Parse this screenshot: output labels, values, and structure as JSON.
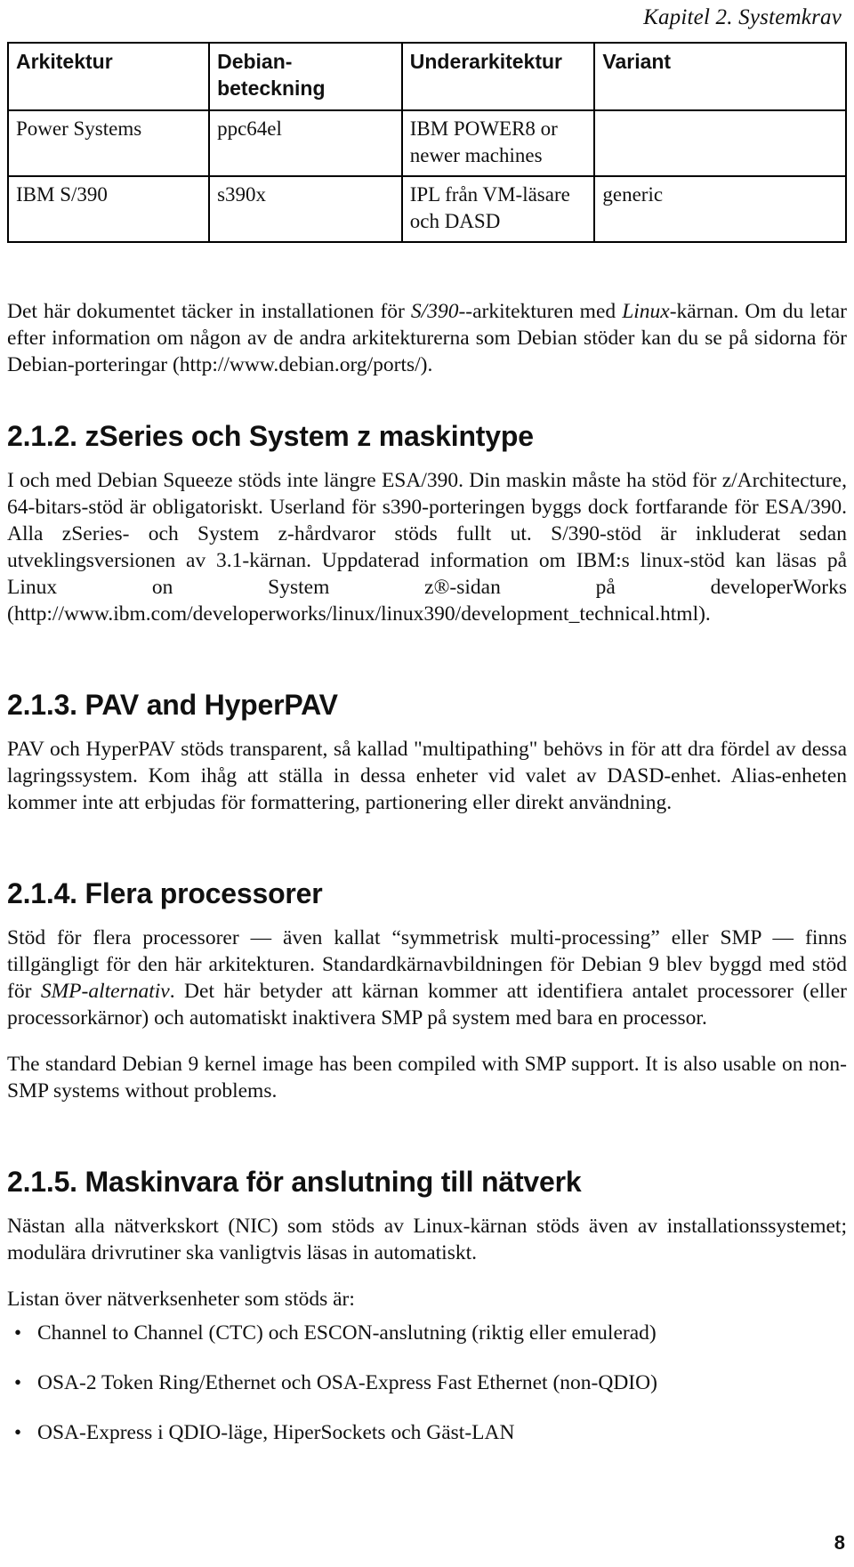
{
  "header": {
    "chapter_label": "Kapitel 2. Systemkrav"
  },
  "table": {
    "headers": [
      "Arkitektur",
      "Debian-beteckning",
      "Underarkitektur",
      "Variant"
    ],
    "rows": [
      {
        "arkitektur": "Power Systems",
        "beteckning": "ppc64el",
        "underarkitektur": "IBM POWER8 or newer machines",
        "variant": ""
      },
      {
        "arkitektur": "IBM S/390",
        "beteckning": "s390x",
        "underarkitektur": "IPL från VM-läsare och DASD",
        "variant": "generic"
      }
    ]
  },
  "intro": {
    "part1": "Det här dokumentet täcker in installationen för ",
    "em1": "S/390",
    "part2": "--arkitekturen med ",
    "em2": "Linux",
    "part3": "-kärnan. Om du letar efter information om någon av de andra arkitekturerna som Debian stöder kan du se på sidorna för Debian-porteringar (http://www.debian.org/ports/)."
  },
  "sections": [
    {
      "heading": "2.1.2. zSeries och System z maskintype",
      "paragraphs": [
        "I och med Debian Squeeze stöds inte längre ESA/390. Din maskin måste ha stöd för z/Architecture, 64-bitars-stöd är obligatoriskt. Userland för s390-porteringen byggs dock fortfarande för ESA/390. Alla zSeries- och System z-hårdvaror stöds fullt ut. S/390-stöd är inkluderat sedan utveklingsversionen av 3.1-kärnan. Uppdaterad information om IBM:s linux-stöd kan läsas på  Linux on System z®-sidan på developerWorks (http://www.ibm.com/developerworks/linux/linux390/development_technical.html)."
      ]
    },
    {
      "heading": "2.1.3. PAV and HyperPAV",
      "paragraphs": [
        "PAV och HyperPAV stöds transparent, så kallad \"multipathing\" behövs in för att dra fördel av dessa lagringssystem. Kom ihåg att ställa in dessa enheter vid valet av DASD-enhet. Alias-enheten kommer inte att erbjudas för formattering, partionering eller direkt användning."
      ]
    }
  ],
  "smp_section": {
    "heading": "2.1.4. Flera processorer",
    "p1_part1": "Stöd för flera processorer — även kallat “symmetrisk multi-processing” eller SMP — finns tillgängligt för den här arkitekturen. Standardkärnavbildningen för Debian 9 blev byggd med stöd för ",
    "p1_em": "SMP-alternativ",
    "p1_part2": ". Det här betyder att kärnan kommer att identifiera antalet processorer (eller processorkärnor) och automatiskt inaktivera SMP på system med bara en processor.",
    "p2": "The standard Debian 9 kernel image has been compiled with SMP support. It is also usable on non-SMP systems without problems."
  },
  "network_section": {
    "heading": "2.1.5. Maskinvara för anslutning till nätverk",
    "p1": "Nästan alla nätverkskort (NIC) som stöds av Linux-kärnan stöds även av installationssystemet; modulära drivrutiner ska vanligtvis läsas in automatiskt.",
    "p2": "Listan över nätverksenheter som stöds är:",
    "bullet_glyph": "•",
    "items": [
      "Channel to Channel (CTC) och ESCON-anslutning (riktig eller emulerad)",
      "OSA-2 Token Ring/Ethernet och OSA-Express Fast Ethernet (non-QDIO)",
      "OSA-Express i QDIO-läge, HiperSockets och Gäst-LAN"
    ]
  },
  "footer": {
    "page_number": "8"
  }
}
